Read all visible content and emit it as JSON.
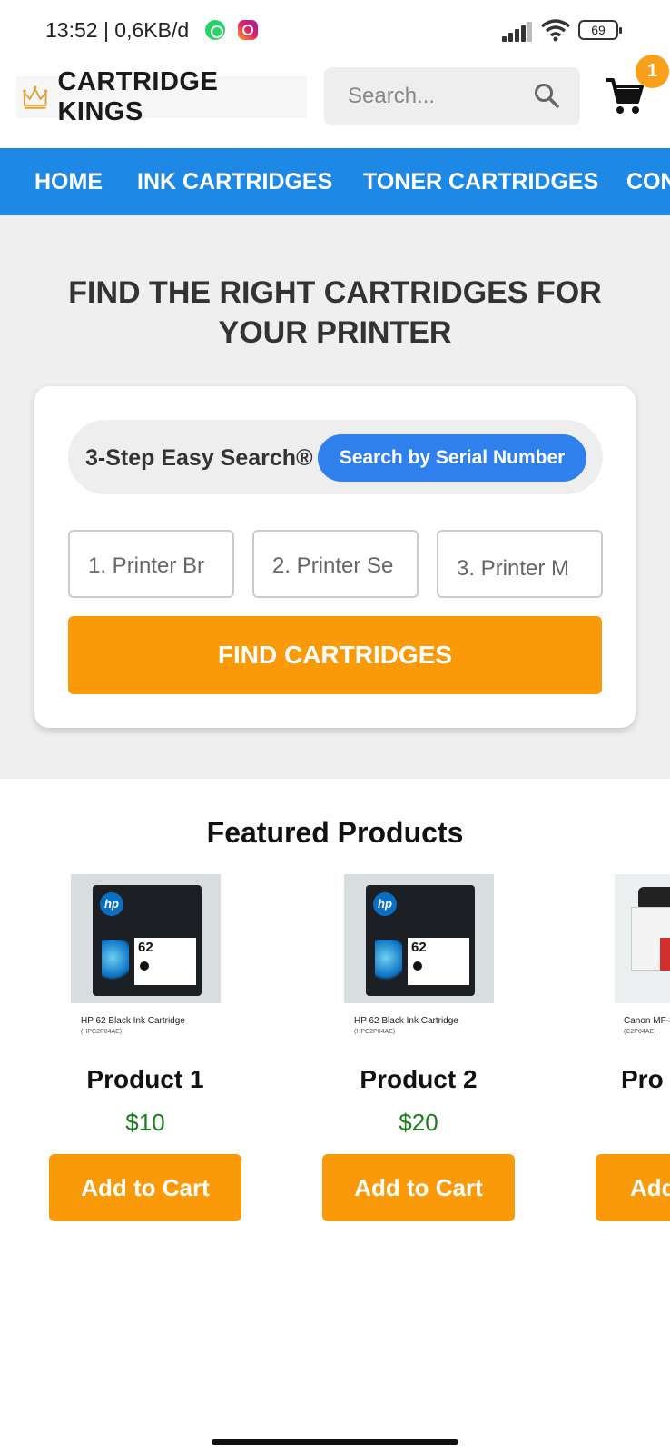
{
  "status_bar": {
    "time": "13:52 | 0,6KB/d",
    "battery": "69"
  },
  "header": {
    "logo_text": "CARTRIDGE KINGS",
    "search_placeholder": "Search...",
    "cart_count": "1"
  },
  "nav": {
    "items": [
      "HOME",
      "INK CARTRIDGES",
      "TONER CARTRIDGES",
      "CON"
    ]
  },
  "hero": {
    "title": "FIND THE RIGHT CARTRIDGES FOR YOUR PRINTER",
    "easy_search_label": "3-Step Easy Search®",
    "serial_button": "Search by Serial Number",
    "selects": [
      "1. Printer Br",
      "2. Printer Se",
      "3. Printer M"
    ],
    "find_button": "FIND CARTRIDGES"
  },
  "featured": {
    "title": "Featured Products",
    "products": [
      {
        "name": "Product 1",
        "price": "$10",
        "caption": "HP 62 Black Ink Cartridge",
        "sku": "(HPC2P04AE)",
        "image_number": "62",
        "add_label": "Add to Cart"
      },
      {
        "name": "Product 2",
        "price": "$20",
        "caption": "HP 62 Black Ink Cartridge",
        "sku": "(HPC2P04AE)",
        "image_number": "62",
        "add_label": "Add to Cart"
      },
      {
        "name": "Pro",
        "price": "",
        "caption": "Canon MF-3",
        "sku": "(C2P04AE)",
        "add_label": "Add"
      }
    ]
  },
  "colors": {
    "nav_blue": "#1e88e5",
    "accent_orange": "#fb9a08",
    "serial_blue": "#2f80ed",
    "price_green": "#1b7d1b"
  }
}
